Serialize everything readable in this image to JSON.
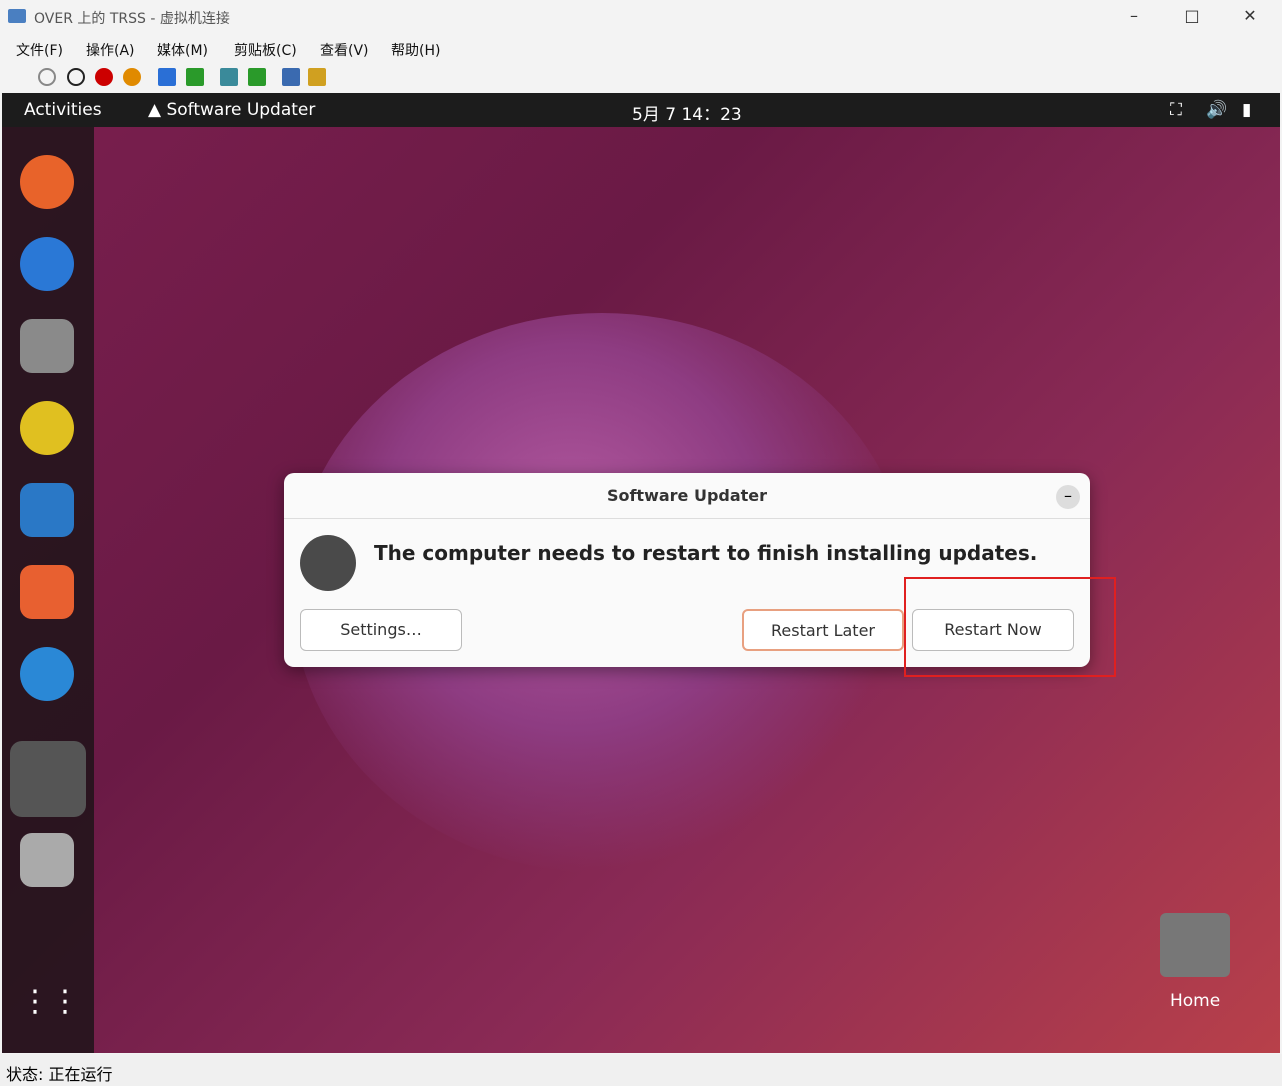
{
  "window": {
    "title": "OVER 上的 TRSS - 虚拟机连接"
  },
  "menu": [
    "文件(F)",
    "操作(A)",
    "媒体(M)",
    "剪贴板(C)",
    "查看(V)",
    "帮助(H)"
  ],
  "topbar": {
    "activities": "Activities",
    "app": "Software Updater",
    "clock": "5月 7  14：23"
  },
  "dialog": {
    "title": "Software Updater",
    "message": "The computer needs to restart to finish installing updates.",
    "settings": "Settings…",
    "later": "Restart Later",
    "now": "Restart Now"
  },
  "desktop": {
    "home": "Home"
  },
  "status": "状态: 正在运行"
}
